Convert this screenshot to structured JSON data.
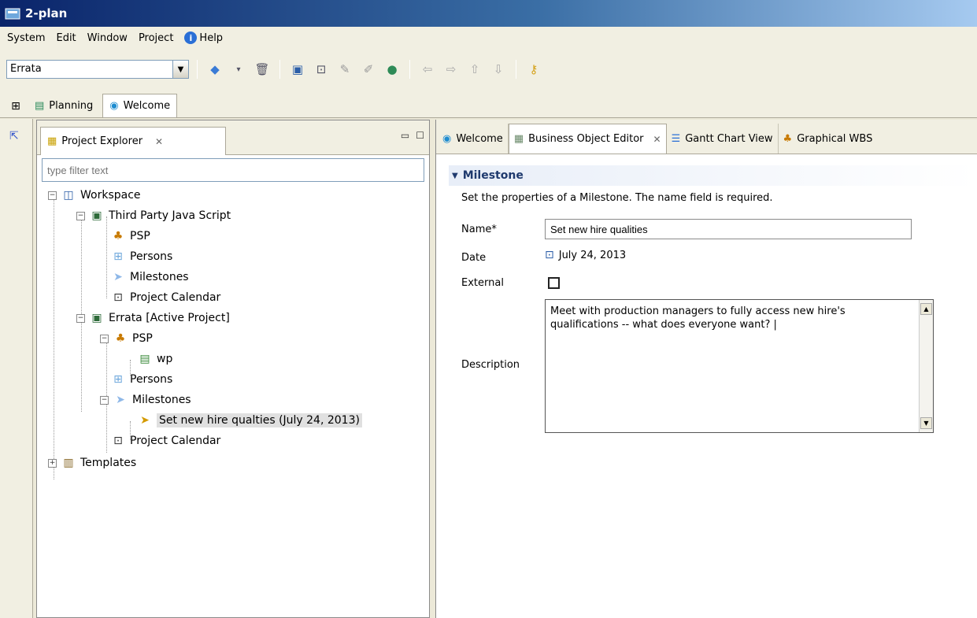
{
  "window": {
    "title": "2-plan"
  },
  "menu": [
    "System",
    "Edit",
    "Window",
    "Project",
    "Help"
  ],
  "toolbar": {
    "project_select": "Errata"
  },
  "perspectives": [
    "Planning",
    "Welcome"
  ],
  "explorer": {
    "tab_label": "Project Explorer",
    "filter_placeholder": "type filter text",
    "tree": [
      "Workspace",
      "Third Party Java Script",
      "PSP",
      "Persons",
      "Milestones",
      "Project Calendar",
      "Errata  [Active Project]",
      "PSP",
      "wp",
      "Persons",
      "Milestones",
      "Set new hire qualties (July 24, 2013)",
      "Project Calendar",
      "Templates"
    ]
  },
  "editor": {
    "tabs": [
      "Welcome",
      "Business Object Editor",
      "Gantt Chart View",
      "Graphical WBS"
    ],
    "section_title": "Milestone",
    "section_desc": "Set the properties of a Milestone. The name field is required.",
    "labels": {
      "name": "Name*",
      "date": "Date",
      "external": "External",
      "description": "Description"
    },
    "name_value": "Set new hire qualities",
    "date_value": "July 24, 2013",
    "description_value": "Meet with production managers to fully access new hire's qualifications -- what does everyone want? |"
  }
}
